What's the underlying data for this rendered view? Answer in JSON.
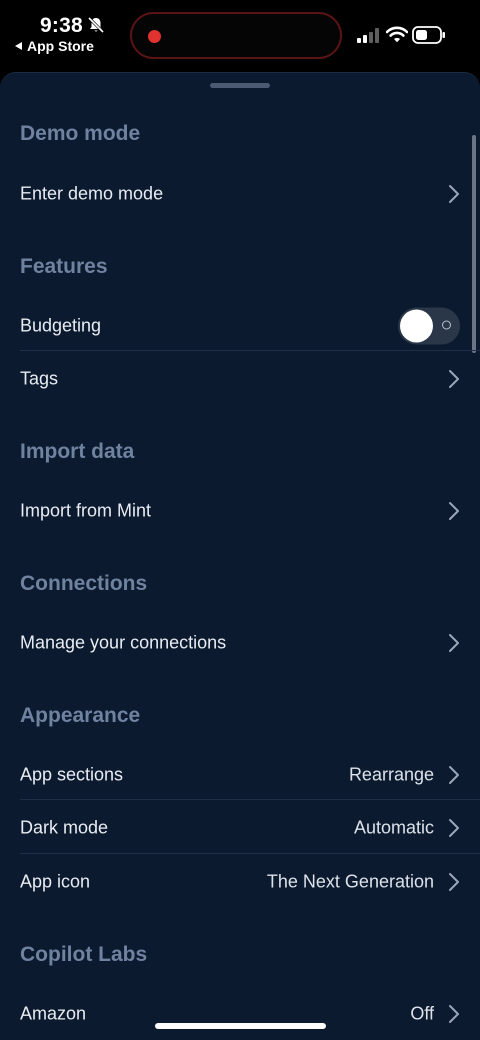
{
  "status_bar": {
    "time": "9:38",
    "back_label": "App Store",
    "recording_color": "#e0322e"
  },
  "sections": {
    "demo": {
      "header": "Demo mode",
      "rows": [
        {
          "label": "Enter demo mode",
          "value": ""
        }
      ]
    },
    "features": {
      "header": "Features",
      "rows": [
        {
          "label": "Budgeting",
          "control": "toggle",
          "state": "off"
        },
        {
          "label": "Tags",
          "value": ""
        }
      ]
    },
    "import": {
      "header": "Import data",
      "rows": [
        {
          "label": "Import from Mint",
          "value": ""
        }
      ]
    },
    "connections": {
      "header": "Connections",
      "rows": [
        {
          "label": "Manage your connections",
          "value": ""
        }
      ]
    },
    "appearance": {
      "header": "Appearance",
      "rows": [
        {
          "label": "App sections",
          "value": "Rearrange"
        },
        {
          "label": "Dark mode",
          "value": "Automatic"
        },
        {
          "label": "App icon",
          "value": "The Next Generation"
        }
      ]
    },
    "labs": {
      "header": "Copilot Labs",
      "rows": [
        {
          "label": "Amazon",
          "value": "Off"
        }
      ]
    }
  },
  "icons": {
    "chevron": "chevron-right-icon",
    "bell": "bell-slash-icon",
    "signal": "cellular-signal-icon",
    "wifi": "wifi-icon",
    "battery": "battery-icon"
  },
  "colors": {
    "sheet_background": "#0b1a2e",
    "section_header": "#6f82a0",
    "row_text": "#e8ecf2"
  }
}
